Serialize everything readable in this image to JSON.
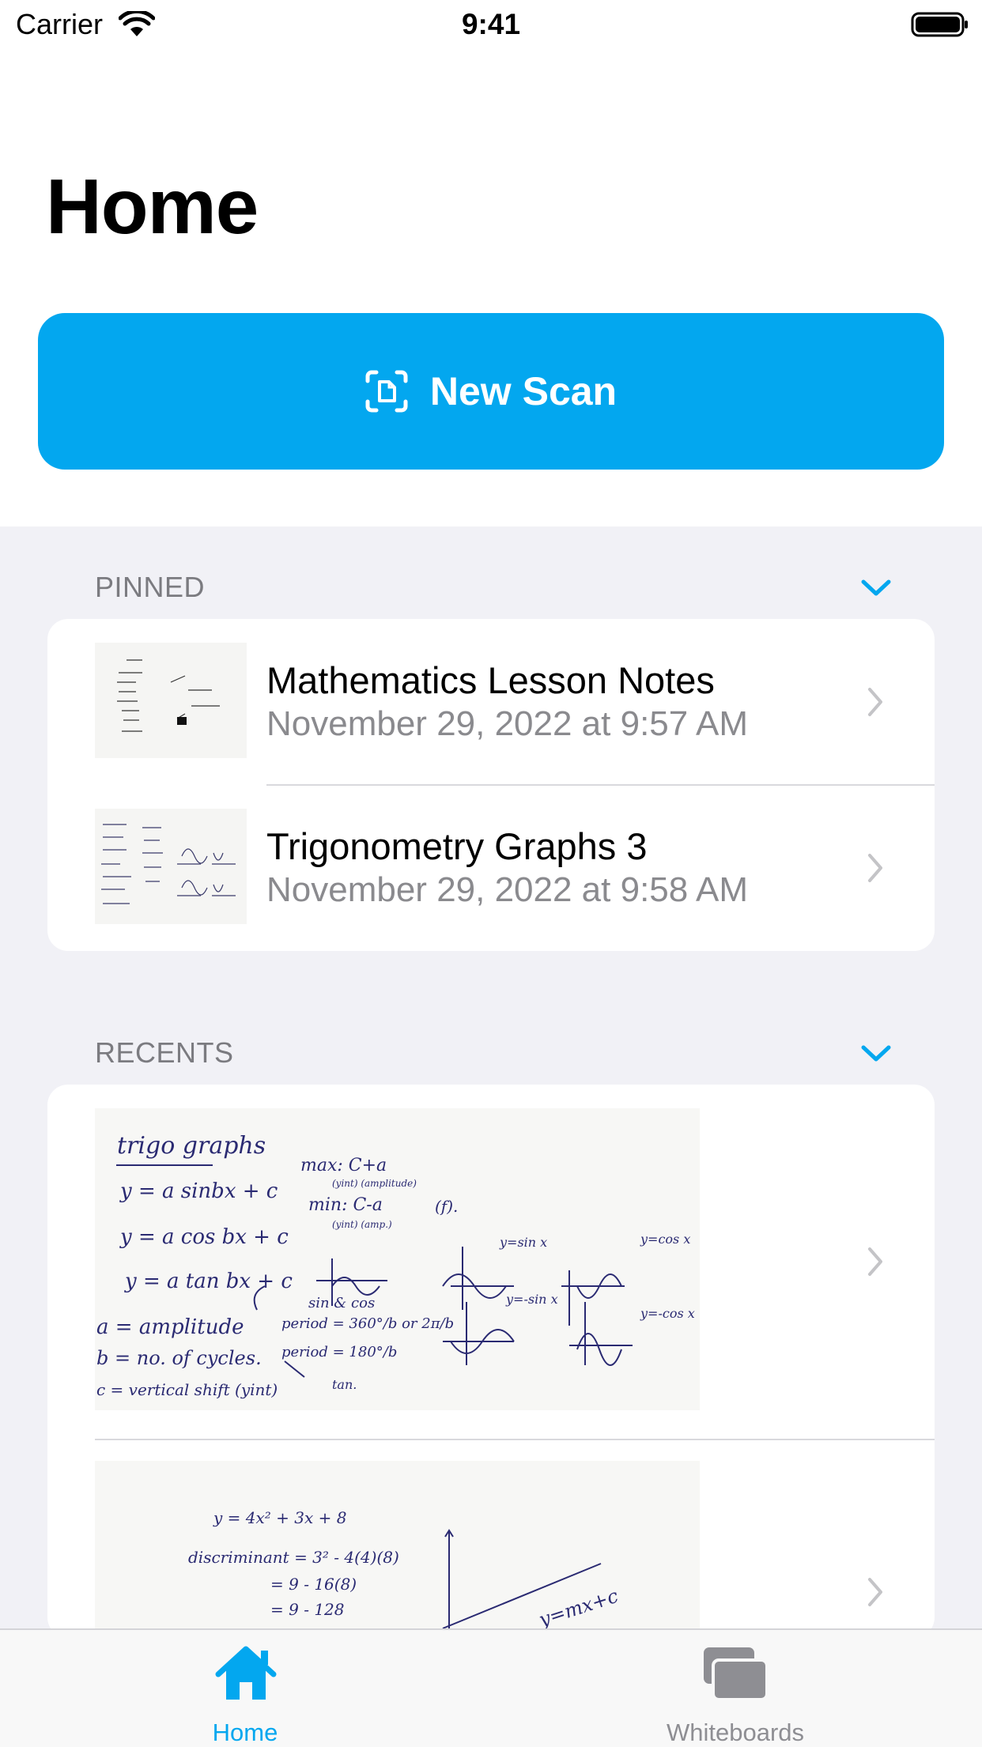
{
  "status_bar": {
    "carrier": "Carrier",
    "time": "9:41"
  },
  "header": {
    "title": "Home"
  },
  "new_scan": {
    "label": "New Scan"
  },
  "pinned": {
    "header": "PINNED",
    "items": [
      {
        "title": "Mathematics Lesson Notes",
        "subtitle": "November 29, 2022 at 9:57 AM"
      },
      {
        "title": "Trigonometry Graphs 3",
        "subtitle": "November 29, 2022 at 9:58 AM"
      }
    ]
  },
  "recents": {
    "header": "RECENTS",
    "items": [
      {
        "lines_left": [
          "trigo graphs",
          "y = a sinbx + c",
          "y = a cos bx + c",
          "y = a tan bx + c",
          "a = amplitude",
          "b = no. of cycles.",
          "c = vertical shift (yint)"
        ],
        "lines_mid": [
          "max: C+a",
          "(yint) (amplitude)",
          "min: C-a",
          "(yint) (amp.)",
          "sin & cos",
          "period = 360°/b or 2π/b",
          "period = 180°/b",
          "tan."
        ],
        "graph_labels": [
          "(f).",
          "y=sin x",
          "y=cos x",
          "y=-sin x",
          "y=-cos x"
        ]
      },
      {
        "lines": [
          "y = 4x² + 3x + 8",
          "discriminant = 3² - 4(4)(8)",
          "= 9 - 16(8)",
          "= 9 - 128"
        ],
        "graph_label": "y=mx+c"
      }
    ]
  },
  "tab_bar": {
    "tabs": [
      {
        "label": "Home",
        "active": true
      },
      {
        "label": "Whiteboards",
        "active": false
      }
    ]
  },
  "colors": {
    "accent": "#03a7ef",
    "inactive": "#8e8e93",
    "grouped_background": "#f1f1f6"
  }
}
